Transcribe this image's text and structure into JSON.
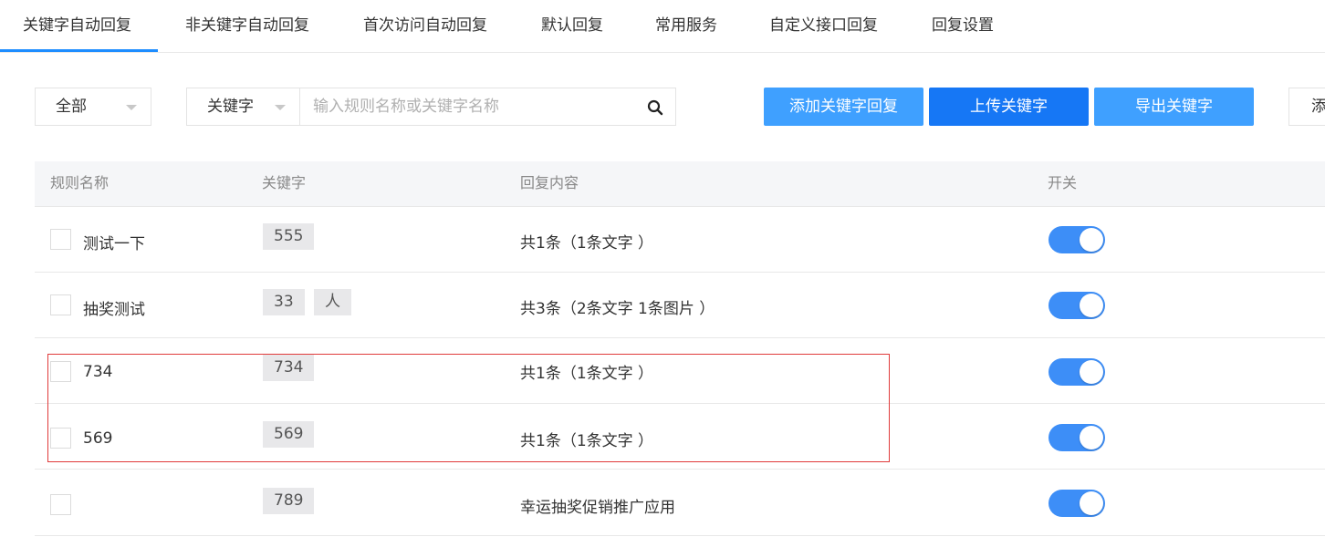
{
  "tabs": [
    {
      "label": "关键字自动回复",
      "active": true
    },
    {
      "label": "非关键字自动回复",
      "active": false
    },
    {
      "label": "首次访问自动回复",
      "active": false
    },
    {
      "label": "默认回复",
      "active": false
    },
    {
      "label": "常用服务",
      "active": false
    },
    {
      "label": "自定义接口回复",
      "active": false
    },
    {
      "label": "回复设置",
      "active": false
    }
  ],
  "filters": {
    "scope_value": "全部",
    "field_value": "关键字",
    "search_placeholder": "输入规则名称或关键字名称"
  },
  "actions": {
    "add_label": "添加关键字回复",
    "upload_label": "上传关键字",
    "export_label": "导出关键字",
    "more_label": "添"
  },
  "table": {
    "columns": [
      "规则名称",
      "关键字",
      "回复内容",
      "开关"
    ],
    "rows": [
      {
        "name": "测试一下",
        "keywords": [
          "555"
        ],
        "reply": "共1条（1条文字 ）",
        "enabled": true
      },
      {
        "name": "抽奖测试",
        "keywords": [
          "33",
          "人"
        ],
        "reply": "共3条（2条文字 1条图片 ）",
        "enabled": true
      },
      {
        "name": "734",
        "keywords": [
          "734"
        ],
        "reply": "共1条（1条文字 ）",
        "enabled": true
      },
      {
        "name": "569",
        "keywords": [
          "569"
        ],
        "reply": "共1条（1条文字 ）",
        "enabled": true
      },
      {
        "name": "",
        "keywords": [
          "789"
        ],
        "reply": "幸运抽奖促销推广应用",
        "enabled": true
      }
    ]
  },
  "colors": {
    "accent": "#1e8dff",
    "button_light": "#3fa0ff",
    "button_dark": "#1677f5",
    "toggle_on": "#3d8ef7",
    "highlight": "#e03a3a"
  }
}
